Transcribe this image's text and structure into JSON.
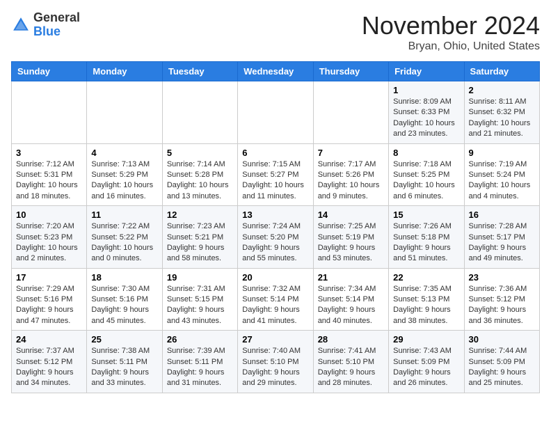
{
  "header": {
    "logo_line1": "General",
    "logo_line2": "Blue",
    "month": "November 2024",
    "location": "Bryan, Ohio, United States"
  },
  "weekdays": [
    "Sunday",
    "Monday",
    "Tuesday",
    "Wednesday",
    "Thursday",
    "Friday",
    "Saturday"
  ],
  "weeks": [
    [
      {
        "day": "",
        "info": ""
      },
      {
        "day": "",
        "info": ""
      },
      {
        "day": "",
        "info": ""
      },
      {
        "day": "",
        "info": ""
      },
      {
        "day": "",
        "info": ""
      },
      {
        "day": "1",
        "info": "Sunrise: 8:09 AM\nSunset: 6:33 PM\nDaylight: 10 hours and 23 minutes."
      },
      {
        "day": "2",
        "info": "Sunrise: 8:11 AM\nSunset: 6:32 PM\nDaylight: 10 hours and 21 minutes."
      }
    ],
    [
      {
        "day": "3",
        "info": "Sunrise: 7:12 AM\nSunset: 5:31 PM\nDaylight: 10 hours and 18 minutes."
      },
      {
        "day": "4",
        "info": "Sunrise: 7:13 AM\nSunset: 5:29 PM\nDaylight: 10 hours and 16 minutes."
      },
      {
        "day": "5",
        "info": "Sunrise: 7:14 AM\nSunset: 5:28 PM\nDaylight: 10 hours and 13 minutes."
      },
      {
        "day": "6",
        "info": "Sunrise: 7:15 AM\nSunset: 5:27 PM\nDaylight: 10 hours and 11 minutes."
      },
      {
        "day": "7",
        "info": "Sunrise: 7:17 AM\nSunset: 5:26 PM\nDaylight: 10 hours and 9 minutes."
      },
      {
        "day": "8",
        "info": "Sunrise: 7:18 AM\nSunset: 5:25 PM\nDaylight: 10 hours and 6 minutes."
      },
      {
        "day": "9",
        "info": "Sunrise: 7:19 AM\nSunset: 5:24 PM\nDaylight: 10 hours and 4 minutes."
      }
    ],
    [
      {
        "day": "10",
        "info": "Sunrise: 7:20 AM\nSunset: 5:23 PM\nDaylight: 10 hours and 2 minutes."
      },
      {
        "day": "11",
        "info": "Sunrise: 7:22 AM\nSunset: 5:22 PM\nDaylight: 10 hours and 0 minutes."
      },
      {
        "day": "12",
        "info": "Sunrise: 7:23 AM\nSunset: 5:21 PM\nDaylight: 9 hours and 58 minutes."
      },
      {
        "day": "13",
        "info": "Sunrise: 7:24 AM\nSunset: 5:20 PM\nDaylight: 9 hours and 55 minutes."
      },
      {
        "day": "14",
        "info": "Sunrise: 7:25 AM\nSunset: 5:19 PM\nDaylight: 9 hours and 53 minutes."
      },
      {
        "day": "15",
        "info": "Sunrise: 7:26 AM\nSunset: 5:18 PM\nDaylight: 9 hours and 51 minutes."
      },
      {
        "day": "16",
        "info": "Sunrise: 7:28 AM\nSunset: 5:17 PM\nDaylight: 9 hours and 49 minutes."
      }
    ],
    [
      {
        "day": "17",
        "info": "Sunrise: 7:29 AM\nSunset: 5:16 PM\nDaylight: 9 hours and 47 minutes."
      },
      {
        "day": "18",
        "info": "Sunrise: 7:30 AM\nSunset: 5:16 PM\nDaylight: 9 hours and 45 minutes."
      },
      {
        "day": "19",
        "info": "Sunrise: 7:31 AM\nSunset: 5:15 PM\nDaylight: 9 hours and 43 minutes."
      },
      {
        "day": "20",
        "info": "Sunrise: 7:32 AM\nSunset: 5:14 PM\nDaylight: 9 hours and 41 minutes."
      },
      {
        "day": "21",
        "info": "Sunrise: 7:34 AM\nSunset: 5:14 PM\nDaylight: 9 hours and 40 minutes."
      },
      {
        "day": "22",
        "info": "Sunrise: 7:35 AM\nSunset: 5:13 PM\nDaylight: 9 hours and 38 minutes."
      },
      {
        "day": "23",
        "info": "Sunrise: 7:36 AM\nSunset: 5:12 PM\nDaylight: 9 hours and 36 minutes."
      }
    ],
    [
      {
        "day": "24",
        "info": "Sunrise: 7:37 AM\nSunset: 5:12 PM\nDaylight: 9 hours and 34 minutes."
      },
      {
        "day": "25",
        "info": "Sunrise: 7:38 AM\nSunset: 5:11 PM\nDaylight: 9 hours and 33 minutes."
      },
      {
        "day": "26",
        "info": "Sunrise: 7:39 AM\nSunset: 5:11 PM\nDaylight: 9 hours and 31 minutes."
      },
      {
        "day": "27",
        "info": "Sunrise: 7:40 AM\nSunset: 5:10 PM\nDaylight: 9 hours and 29 minutes."
      },
      {
        "day": "28",
        "info": "Sunrise: 7:41 AM\nSunset: 5:10 PM\nDaylight: 9 hours and 28 minutes."
      },
      {
        "day": "29",
        "info": "Sunrise: 7:43 AM\nSunset: 5:09 PM\nDaylight: 9 hours and 26 minutes."
      },
      {
        "day": "30",
        "info": "Sunrise: 7:44 AM\nSunset: 5:09 PM\nDaylight: 9 hours and 25 minutes."
      }
    ]
  ],
  "colors": {
    "header_bg": "#2a7de1",
    "odd_row_bg": "#f5f7fa",
    "even_row_bg": "#ffffff"
  }
}
